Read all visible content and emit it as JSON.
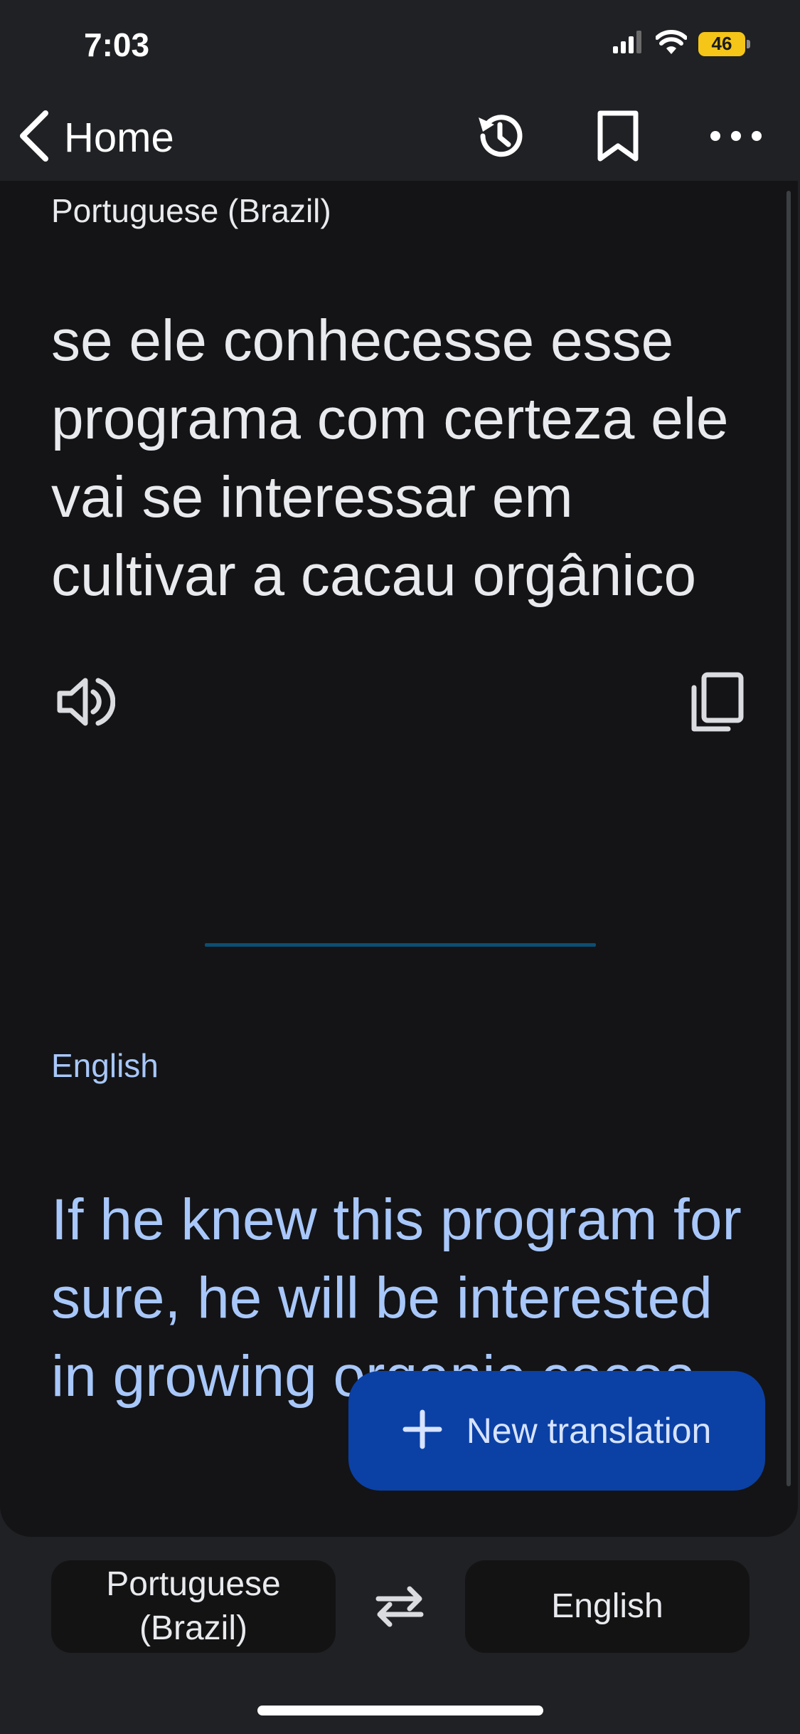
{
  "status_bar": {
    "time": "7:03",
    "battery": "46"
  },
  "nav": {
    "back_label": "Home"
  },
  "source": {
    "language": "Portuguese (Brazil)",
    "text": "se ele conhecesse esse programa com certeza ele vai se interessar em cultivar a cacau orgânico"
  },
  "target": {
    "language": "English",
    "text": "If he knew this program for sure, he will be interested in growing organic cocoa"
  },
  "fab": {
    "label": "New translation"
  },
  "language_bar": {
    "source_label": "Portuguese (Brazil)",
    "target_label": "English"
  },
  "colors": {
    "background": "#202124",
    "card": "#141416",
    "accent_text": "#a8c7fa",
    "fab": "#0b41a5",
    "battery": "#f5c518"
  }
}
